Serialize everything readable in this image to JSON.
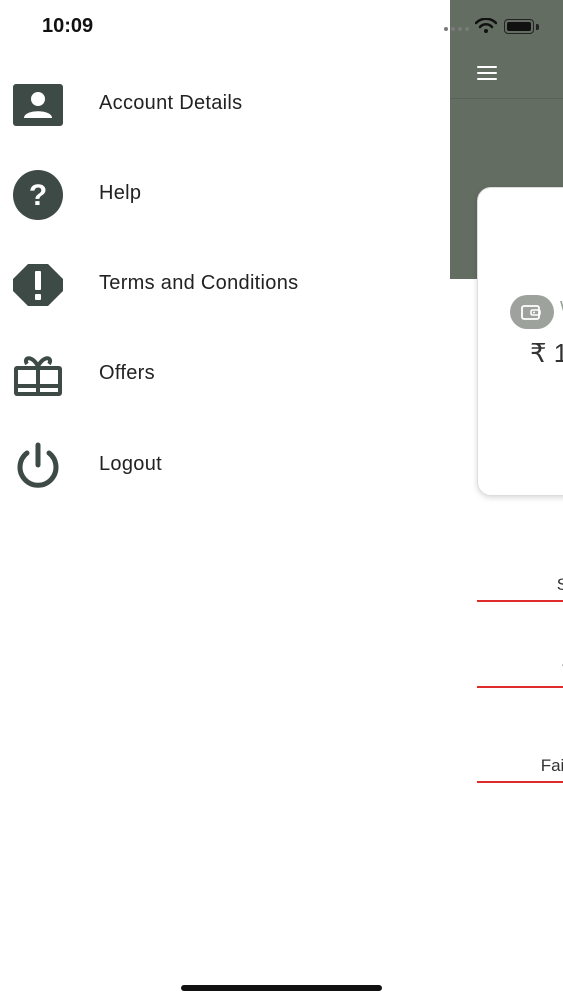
{
  "status_bar": {
    "time": "10:09"
  },
  "drawer": {
    "items": [
      {
        "label": "Account Details",
        "icon": "account-icon"
      },
      {
        "label": "Help",
        "icon": "help-icon"
      },
      {
        "label": "Terms and Conditions",
        "icon": "alert-icon"
      },
      {
        "label": "Offers",
        "icon": "gift-icon"
      },
      {
        "label": "Logout",
        "icon": "power-icon"
      }
    ]
  },
  "background": {
    "header_color": "#646d62",
    "card": {
      "title_partial": "W",
      "amount_partial": "₹ 1"
    },
    "links": [
      "Sho",
      "Tra",
      "Failed"
    ],
    "underline_color": "#e02b2b"
  }
}
